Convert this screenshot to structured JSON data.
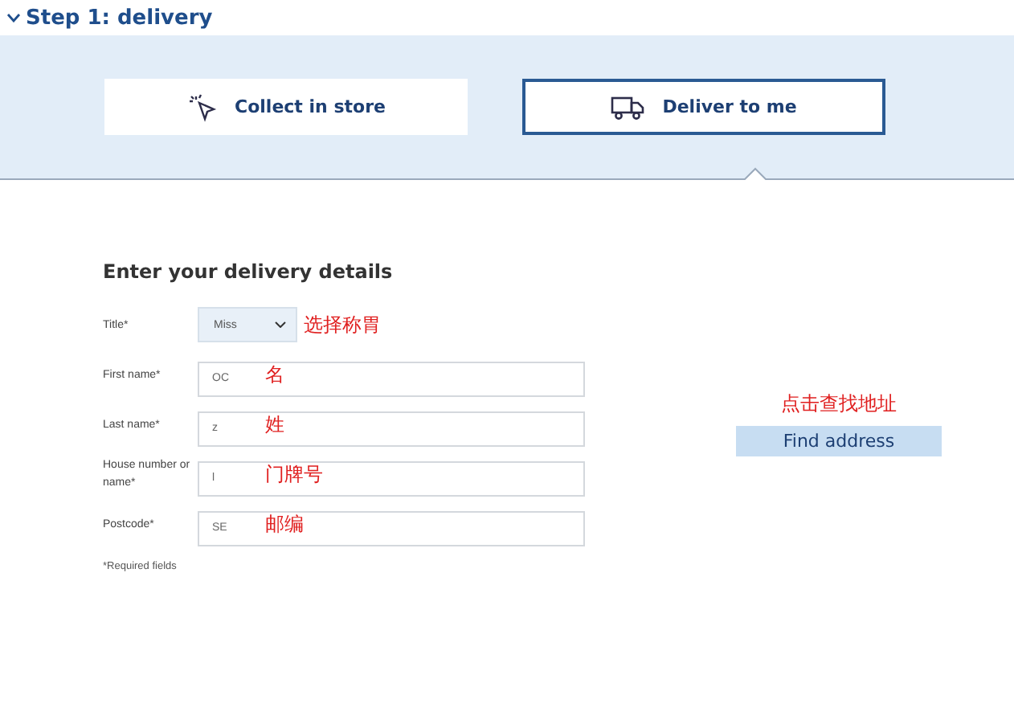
{
  "section": {
    "title": "Step 1: delivery",
    "expanded": true
  },
  "options": [
    {
      "label": "Collect in store",
      "kind": "store",
      "selected": false
    },
    {
      "label": "Deliver to me",
      "kind": "delivery",
      "selected": true
    }
  ],
  "form": {
    "heading": "Enter your delivery details",
    "fields": [
      {
        "kind": "select",
        "label": "Title*",
        "value": "Miss",
        "annotation": "选择称胃"
      },
      {
        "kind": "text",
        "label": "First name*",
        "value": "OC",
        "annotation": "名"
      },
      {
        "kind": "text",
        "label": "Last name*",
        "value": "z",
        "annotation": "姓"
      },
      {
        "kind": "text",
        "label": "House number or name*",
        "value": "l",
        "annotation": "门牌号"
      },
      {
        "kind": "text",
        "label": "Postcode*",
        "value": "SE",
        "annotation": "邮编"
      }
    ],
    "note": "*Required fields",
    "button_annotation": "点击查找地址",
    "button": "Find address"
  }
}
